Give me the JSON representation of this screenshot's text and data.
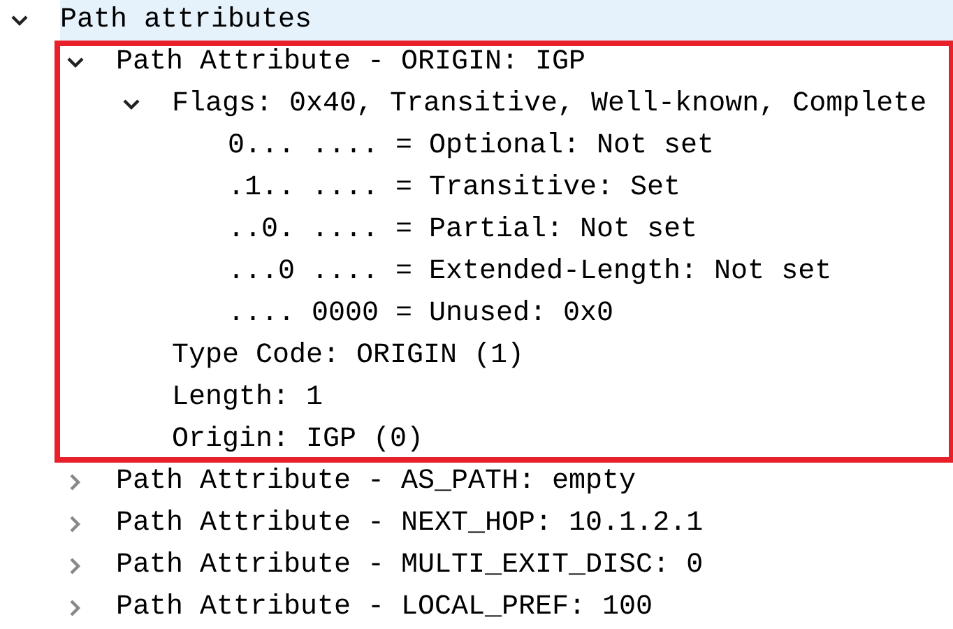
{
  "tree": [
    {
      "label": "Path attributes",
      "expanded": true,
      "selected": true,
      "children": [
        {
          "label": "Path Attribute - ORIGIN: IGP",
          "expanded": true,
          "selected": false,
          "outlined": true,
          "children": [
            {
              "label": "Flags: 0x40, Transitive, Well-known, Complete",
              "expanded": true,
              "selected": false,
              "children": [
                {
                  "label": "0... .... = Optional: Not set",
                  "selected": false
                },
                {
                  "label": ".1.. .... = Transitive: Set",
                  "selected": false
                },
                {
                  "label": "..0. .... = Partial: Not set",
                  "selected": false
                },
                {
                  "label": "...0 .... = Extended-Length: Not set",
                  "selected": false
                },
                {
                  "label": ".... 0000 = Unused: 0x0",
                  "selected": false
                }
              ]
            },
            {
              "label": "Type Code: ORIGIN (1)",
              "selected": false
            },
            {
              "label": "Length: 1",
              "selected": false
            },
            {
              "label": "Origin: IGP (0)",
              "selected": false
            }
          ]
        },
        {
          "label": "Path Attribute - AS_PATH: empty",
          "expanded": false,
          "selected": false,
          "outlined": false
        },
        {
          "label": "Path Attribute - NEXT_HOP: 10.1.2.1",
          "expanded": false,
          "selected": false,
          "outlined": false
        },
        {
          "label": "Path Attribute - MULTI_EXIT_DISC: 0",
          "expanded": false,
          "selected": false,
          "outlined": false
        },
        {
          "label": "Path Attribute - LOCAL_PREF: 100",
          "expanded": false,
          "selected": false,
          "outlined": false
        }
      ]
    }
  ]
}
